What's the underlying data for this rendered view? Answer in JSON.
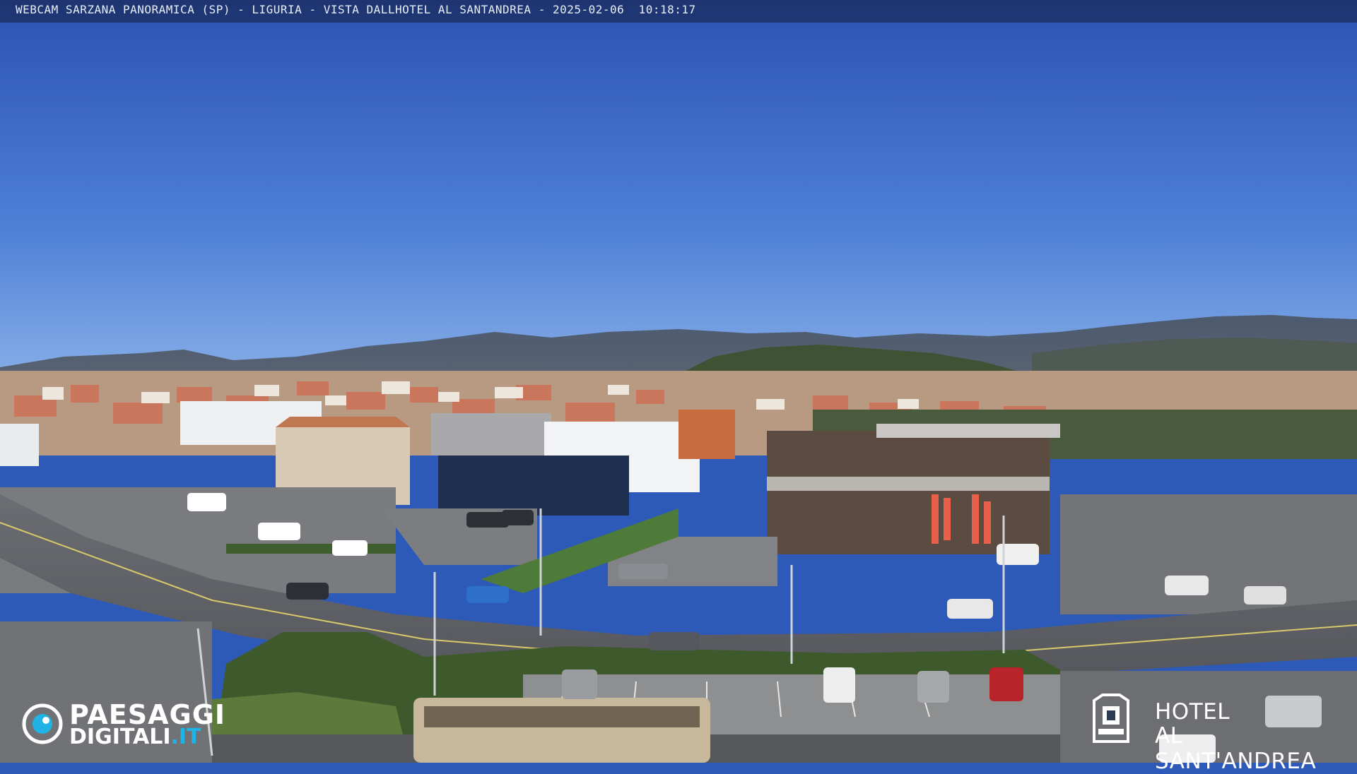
{
  "osd": {
    "caption": "WEBCAM SARZANA PANORAMICA (SP) - LIGURIA - VISTA DALLHOTEL AL SANTANDREA - 2025-02-06  10:18:17"
  },
  "logo_left": {
    "line1": "PAESAGGI",
    "line2_main": "DIGITALI",
    "line2_tld": ".IT",
    "icon": "eye-icon",
    "accent_color": "#1fb3e6"
  },
  "logo_right": {
    "line1": "HOTEL",
    "line2": "AL SANT'ANDREA",
    "icon": "hotel-emblem-icon"
  },
  "colors": {
    "sky_top": "#2a55b8",
    "sky_horizon": "#7ba6e8"
  }
}
